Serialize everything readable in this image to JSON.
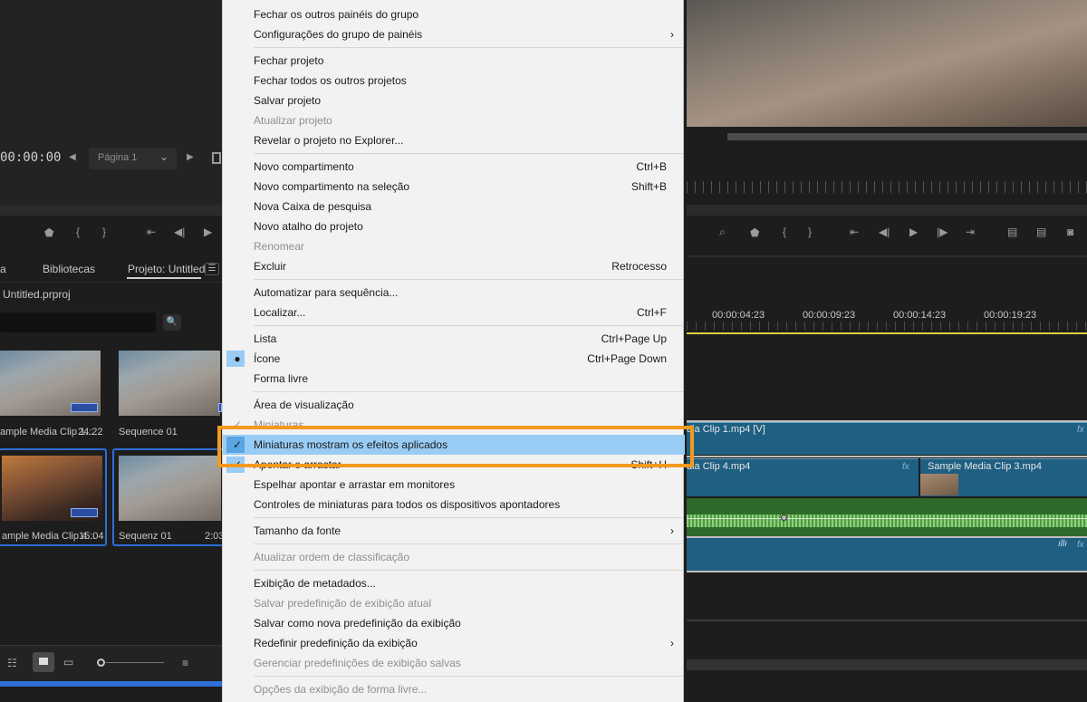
{
  "source_monitor": {
    "timecode": "00:00:00",
    "page_selector": "Página 1"
  },
  "project_panel": {
    "tabs": [
      "a",
      "Bibliotecas",
      "Projeto: Untitled"
    ],
    "file_name": "Untitled.prproj",
    "items": [
      {
        "name": "ample Media Clip 1...",
        "duration": "24:22"
      },
      {
        "name": "Sequence 01",
        "duration": ""
      },
      {
        "name": "ample Media Clip 4...",
        "duration": "15:04"
      },
      {
        "name": "Sequenz 01",
        "duration": "2:03"
      }
    ]
  },
  "timeline": {
    "timecodes": [
      "00:00:04:23",
      "00:00:09:23",
      "00:00:14:23",
      "00:00:19:23"
    ],
    "clips": {
      "v2": "dia Clip 1.mp4 [V]",
      "v1a": "dia Clip 4.mp4",
      "v1b": "Sample Media Clip 3.mp4"
    },
    "fx_label": "fx"
  },
  "context_menu": {
    "items": [
      {
        "label": "Fechar os outros painéis do grupo",
        "shortcut": "",
        "disabled": false
      },
      {
        "label": "Configurações do grupo de painéis",
        "shortcut": "",
        "submenu": true
      },
      {
        "label": "Fechar projeto",
        "shortcut": ""
      },
      {
        "label": "Fechar todos os outros projetos",
        "shortcut": ""
      },
      {
        "label": "Salvar projeto",
        "shortcut": ""
      },
      {
        "label": "Atualizar projeto",
        "shortcut": "",
        "disabled": true
      },
      {
        "label": "Revelar o projeto no Explorer...",
        "shortcut": ""
      },
      {
        "label": "Novo compartimento",
        "shortcut": "Ctrl+B"
      },
      {
        "label": "Novo compartimento na seleção",
        "shortcut": "Shift+B"
      },
      {
        "label": "Nova Caixa de pesquisa",
        "shortcut": ""
      },
      {
        "label": "Novo atalho do projeto",
        "shortcut": ""
      },
      {
        "label": "Renomear",
        "shortcut": "",
        "disabled": true
      },
      {
        "label": "Excluir",
        "shortcut": "Retrocesso"
      },
      {
        "label": "Automatizar para sequência...",
        "shortcut": ""
      },
      {
        "label": "Localizar...",
        "shortcut": "Ctrl+F"
      },
      {
        "label": "Lista",
        "shortcut": "Ctrl+Page Up"
      },
      {
        "label": "Ícone",
        "shortcut": "Ctrl+Page Down",
        "selected": true
      },
      {
        "label": "Forma livre",
        "shortcut": ""
      },
      {
        "label": "Área de visualização",
        "shortcut": ""
      },
      {
        "label": "Miniaturas",
        "shortcut": "",
        "disabled": true
      },
      {
        "label": "Miniaturas mostram os efeitos aplicados",
        "shortcut": "",
        "checked": true,
        "highlighted": true
      },
      {
        "label": "Apontar e arrastar",
        "shortcut": "Shift+H",
        "checked": true
      },
      {
        "label": "Espelhar apontar e arrastar em monitores",
        "shortcut": ""
      },
      {
        "label": "Controles de miniaturas para todos os dispositivos apontadores",
        "shortcut": ""
      },
      {
        "label": "Tamanho da fonte",
        "shortcut": "",
        "submenu": true
      },
      {
        "label": "Atualizar ordem de classificação",
        "shortcut": "",
        "disabled": true
      },
      {
        "label": "Exibição de metadados...",
        "shortcut": ""
      },
      {
        "label": "Salvar predefinição de exibição atual",
        "shortcut": "",
        "disabled": true
      },
      {
        "label": "Salvar como nova predefinição da exibição",
        "shortcut": ""
      },
      {
        "label": "Redefinir predefinição da exibição",
        "shortcut": "",
        "submenu": true
      },
      {
        "label": "Gerenciar predefinições de exibição salvas",
        "shortcut": "",
        "disabled": true
      },
      {
        "label": "Opções da exibição de forma livre...",
        "shortcut": "",
        "disabled": true
      }
    ]
  },
  "colors": {
    "highlight_box": "#f39a1e",
    "menu_hover": "#99ccf5",
    "clip_blue": "#1f5f82",
    "audio_green": "#2e6b2a"
  }
}
